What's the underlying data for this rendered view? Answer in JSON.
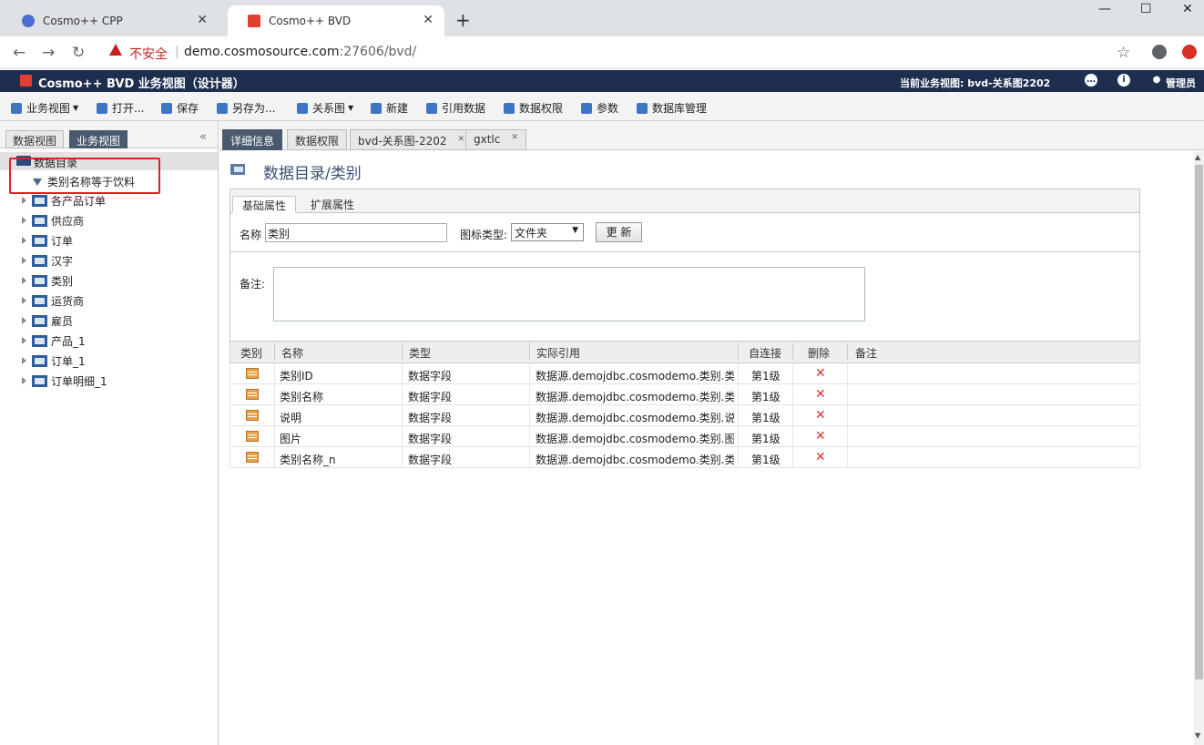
{
  "browser": {
    "tabs": [
      {
        "title": "Cosmo++ CPP"
      },
      {
        "title": "Cosmo++ BVD"
      }
    ],
    "new_tab": "+",
    "window": {
      "minimize": "—",
      "maximize": "☐",
      "close": "✕"
    },
    "address": {
      "security_text": "不安全",
      "host": "demo.cosmosource.com",
      "path": ":27606/bvd/"
    }
  },
  "app": {
    "title": "Cosmo++ BVD 业务视图（设计器）",
    "current_view": "当前业务视图: bvd-关系图2202",
    "user": "管理员"
  },
  "toolbar": {
    "business_view": "业务视图",
    "open": "打开...",
    "save": "保存",
    "save_as": "另存为...",
    "relation": "关系图",
    "new": "新建",
    "ref_data": "引用数据",
    "data_perm": "数据权限",
    "params": "参数",
    "db_manage": "数据库管理"
  },
  "left": {
    "tabs": [
      "数据视图",
      "业务视图"
    ],
    "root": "数据目录",
    "filter_item": "类别名称等于饮料",
    "nodes": [
      "各产品订单",
      "供应商",
      "订单",
      "汉字",
      "类别",
      "运货商",
      "雇员",
      "产品_1",
      "订单_1",
      "订单明细_1"
    ]
  },
  "main": {
    "tabs": [
      "详细信息",
      "数据权限",
      "bvd-关系图-2202",
      "gxtlc"
    ],
    "page_title": "数据目录/类别",
    "prop_tabs": [
      "基础属性",
      "扩展属性"
    ],
    "name_label": "名称",
    "name_value": "类别",
    "icon_type_label": "图标类型:",
    "icon_type_value": "文件夹",
    "update_button": "更 新",
    "remark_label": "备注:",
    "grid": {
      "headers": [
        "类别",
        "名称",
        "类型",
        "实际引用",
        "自连接",
        "删除",
        "备注"
      ],
      "rows": [
        {
          "name": "类别ID",
          "type": "数据字段",
          "ref": "数据源.demojdbc.cosmodemo.类别.类...",
          "self": "第1级"
        },
        {
          "name": "类别名称",
          "type": "数据字段",
          "ref": "数据源.demojdbc.cosmodemo.类别.类...",
          "self": "第1级"
        },
        {
          "name": "说明",
          "type": "数据字段",
          "ref": "数据源.demojdbc.cosmodemo.类别.说明",
          "self": "第1级"
        },
        {
          "name": "图片",
          "type": "数据字段",
          "ref": "数据源.demojdbc.cosmodemo.类别.图片",
          "self": "第1级"
        },
        {
          "name": "类别名称_n",
          "type": "数据字段",
          "ref": "数据源.demojdbc.cosmodemo.类别.类...",
          "self": "第1级"
        }
      ]
    }
  }
}
